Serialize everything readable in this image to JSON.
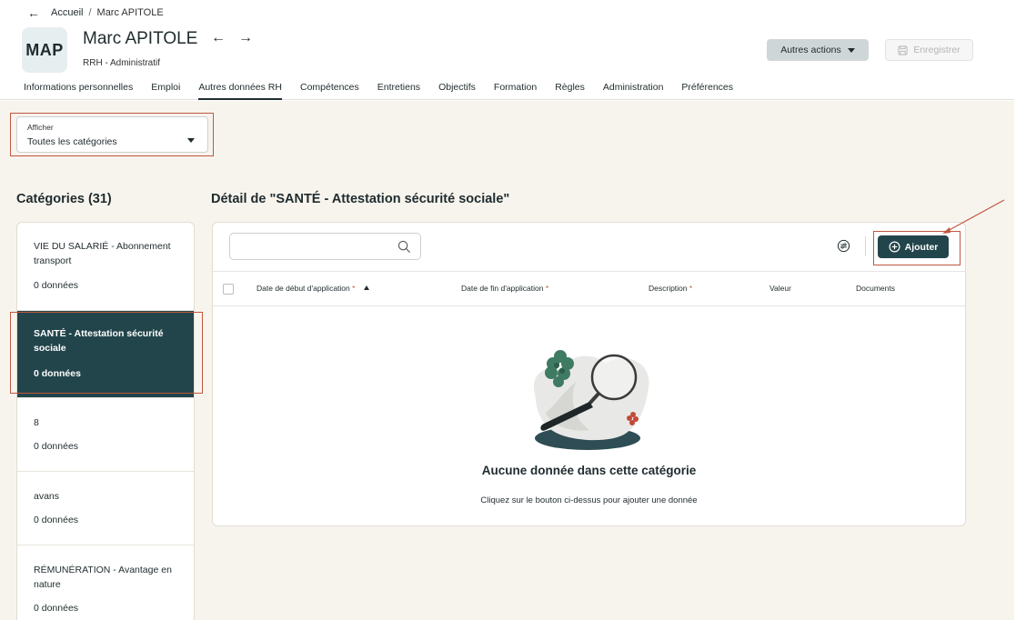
{
  "breadcrumb": {
    "back_icon": "arrow-left-icon",
    "home": "Accueil",
    "separator": "/",
    "current": "Marc APITOLE"
  },
  "person": {
    "initials": "MAP",
    "name": "Marc APITOLE",
    "role": "RRH - Administratif"
  },
  "actions": {
    "more_label": "Autres actions",
    "save_label": "Enregistrer"
  },
  "tabs": [
    {
      "label": "Informations personnelles"
    },
    {
      "label": "Emploi"
    },
    {
      "label": "Autres données RH",
      "active": true
    },
    {
      "label": "Compétences"
    },
    {
      "label": "Entretiens"
    },
    {
      "label": "Objectifs"
    },
    {
      "label": "Formation"
    },
    {
      "label": "Règles"
    },
    {
      "label": "Administration"
    },
    {
      "label": "Préférences"
    }
  ],
  "filter": {
    "label": "Afficher",
    "value": "Toutes les catégories"
  },
  "categories": {
    "title": "Catégories (31)",
    "items": [
      {
        "name": "VIE DU SALARIÉ - Abonnement transport",
        "count": "0 données"
      },
      {
        "name": "SANTÉ - Attestation sécurité sociale",
        "count": "0 données",
        "selected": true
      },
      {
        "name": "8",
        "count": "0 données"
      },
      {
        "name": "avans",
        "count": "0 données"
      },
      {
        "name": "RÉMUNÉRATION - Avantage en nature",
        "count": "0 données"
      }
    ]
  },
  "detail": {
    "title": "Détail de \"SANTÉ - Attestation sécurité sociale\"",
    "search_placeholder": "",
    "add_label": "Ajouter",
    "columns": [
      {
        "label": "Date de début d'application",
        "required": "*",
        "sorted": "asc"
      },
      {
        "label": "Date de fin d'application",
        "required": "*"
      },
      {
        "label": "Description",
        "required": "*"
      },
      {
        "label": "Valeur",
        "required": ""
      },
      {
        "label": "Documents",
        "required": ""
      }
    ],
    "empty_title": "Aucune donnée dans cette catégorie",
    "empty_subtitle": "Cliquez sur le bouton ci-dessus pour ajouter une donnée"
  },
  "colors": {
    "primary": "#22454b",
    "highlight": "#c0573f",
    "background": "#f7f4ee"
  }
}
